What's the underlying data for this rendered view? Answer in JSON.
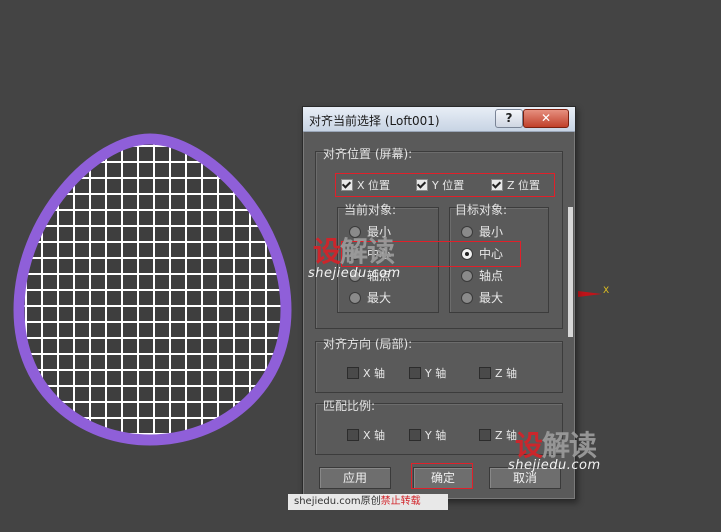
{
  "dialog": {
    "title": "对齐当前选择 (Loft001)",
    "help_label": "?",
    "close_label": "✕",
    "align_position": {
      "title": "对齐位置 (屏幕):",
      "x_label": "X 位置",
      "x_checked": true,
      "y_label": "Y 位置",
      "y_checked": true,
      "z_label": "Z 位置",
      "z_checked": true
    },
    "current_object": {
      "title": "当前对象:",
      "options": [
        "最小",
        "中心",
        "轴点",
        "最大"
      ],
      "selected": null
    },
    "target_object": {
      "title": "目标对象:",
      "options": [
        "最小",
        "中心",
        "轴点",
        "最大"
      ],
      "selected": "中心"
    },
    "align_orientation": {
      "title": "对齐方向 (局部):",
      "x_label": "X 轴",
      "y_label": "Y 轴",
      "z_label": "Z 轴"
    },
    "match_scale": {
      "title": "匹配比例:",
      "x_label": "X 轴",
      "y_label": "Y 轴",
      "z_label": "Z 轴"
    },
    "buttons": {
      "apply": "应用",
      "ok": "确定",
      "cancel": "取消"
    }
  },
  "viewport": {
    "axis_label": "X",
    "egg_outline_color": "#8f5fd9",
    "grid_color": "#ffffff",
    "axis_color": "#c0141a"
  },
  "watermark": {
    "logo_red": "设",
    "logo_gray": "解读",
    "url": "shejiedu.com",
    "footer_site": "shejiedu.com原创",
    "footer_notice": "禁止转载"
  },
  "highlight_color": "#e0202a"
}
